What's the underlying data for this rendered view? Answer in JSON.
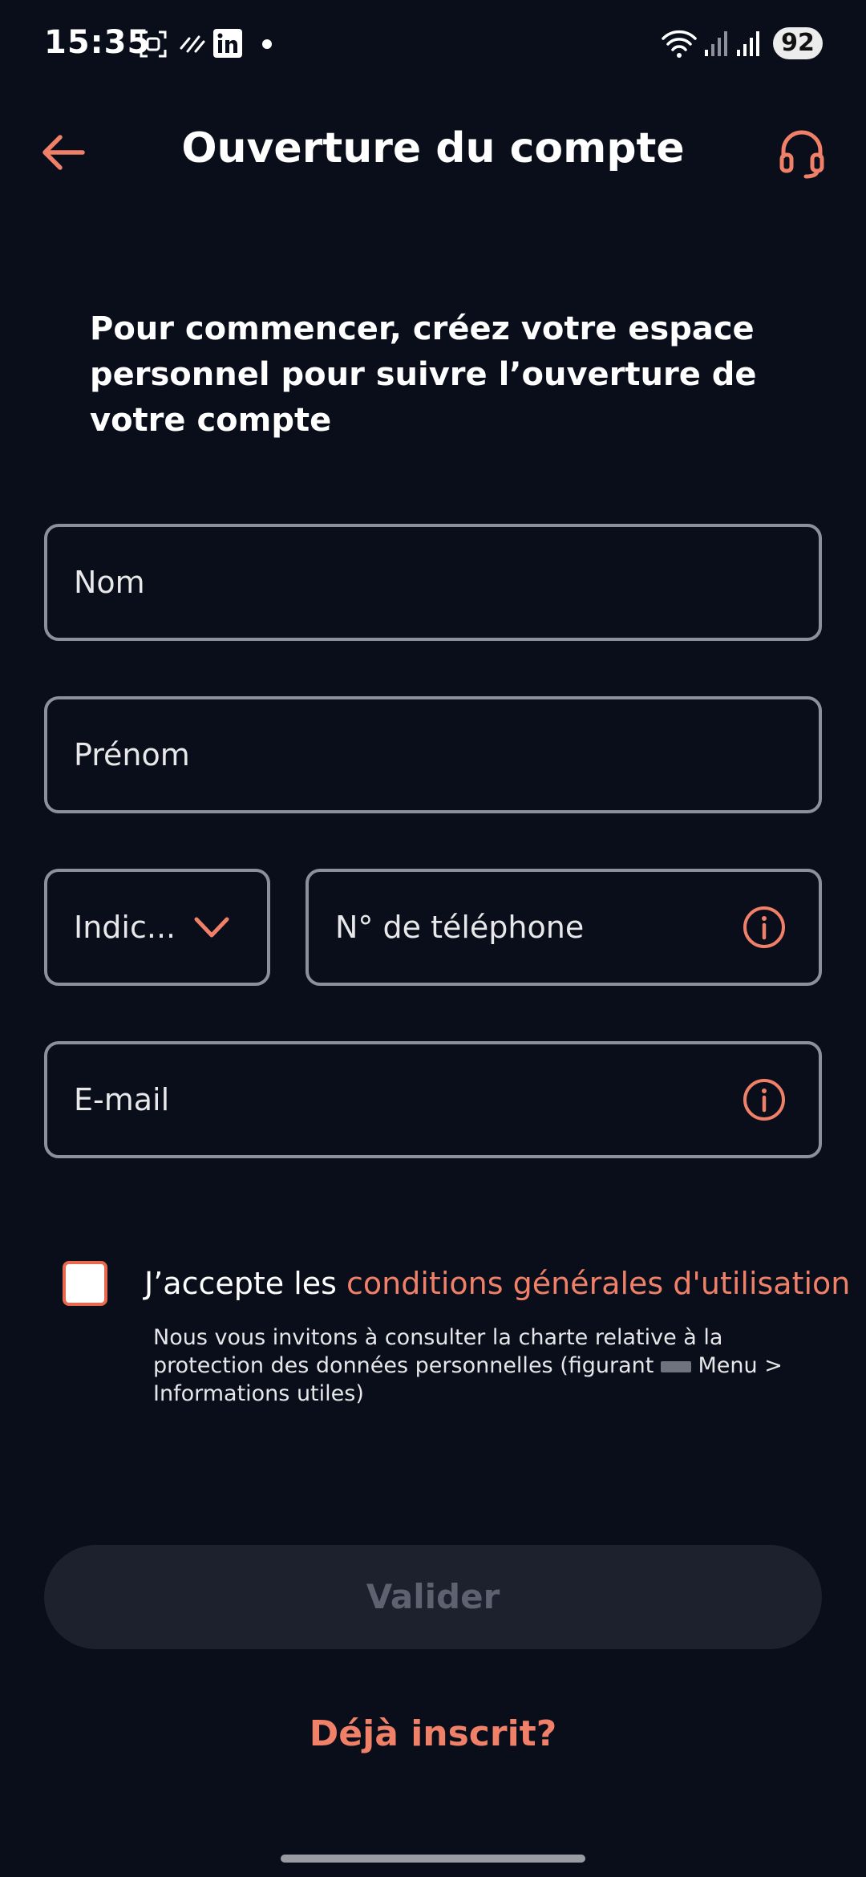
{
  "status_bar": {
    "time": "15:35",
    "battery": "92",
    "icons": [
      "screenshot-icon",
      "sync-icon",
      "linkedin-icon",
      "notification-dot-icon",
      "wifi-icon",
      "signal-icon",
      "signal-icon"
    ]
  },
  "header": {
    "title": "Ouverture du compte",
    "back_icon": "arrow-left-icon",
    "support_icon": "headset-icon"
  },
  "intro": {
    "text": "Pour commencer, créez votre espace personnel pour suivre l’ouverture de votre compte"
  },
  "form": {
    "nom_label": "Nom",
    "prenom_label": "Prénom",
    "indicatif_label": "Indic...",
    "telephone_label": "N° de téléphone",
    "email_label": "E-mail"
  },
  "terms": {
    "accept_prefix": "J’accepte les ",
    "accept_link": "conditions générales d'utilisation",
    "note_part1": "Nous vous invitons à consulter la charte relative à la protection des données personnelles (figurant ",
    "note_part2": " Menu > Informations utiles)"
  },
  "actions": {
    "validate_label": "Valider",
    "already_registered": "Déjà inscrit?"
  },
  "colors": {
    "background": "#090e1a",
    "accent": "#f08068",
    "field_border": "#8d909c",
    "button_disabled_bg": "#1c212d",
    "button_disabled_text": "#5d6270"
  }
}
